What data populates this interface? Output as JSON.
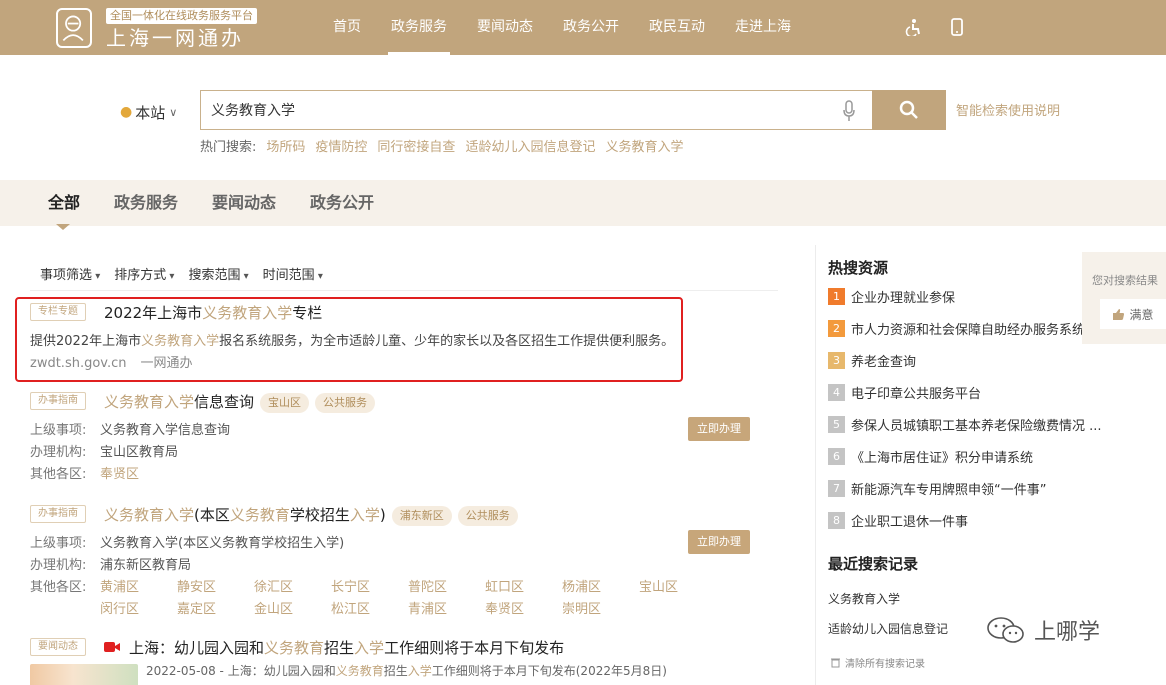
{
  "header": {
    "subtitle": "全国一体化在线政务服务平台",
    "title": "上海一网通办",
    "nav": [
      "首页",
      "政务服务",
      "要闻动态",
      "政务公开",
      "政民互动",
      "走进上海"
    ],
    "active_nav": "政务服务"
  },
  "search": {
    "location": "本站",
    "value": "义务教育入学",
    "help": "智能检索使用说明",
    "hot_label": "热门搜索:",
    "hot_terms": [
      "场所码",
      "疫情防控",
      "同行密接自查",
      "适龄幼儿入园信息登记",
      "义务教育入学"
    ]
  },
  "tabs": [
    "全部",
    "政务服务",
    "要闻动态",
    "政务公开"
  ],
  "filters": [
    "事项筛选",
    "排序方式",
    "搜索范围",
    "时间范围"
  ],
  "results": {
    "r1": {
      "tag": "专栏专题",
      "title_a": "2022年上海市",
      "title_hl": "义务教育入学",
      "title_b": "专栏",
      "desc_a": "提供2022年上海市",
      "desc_hl": "义务教育入学",
      "desc_b": "报名系统服务，为全市适龄儿童、少年的家长以及各区招生工作提供便利服务。",
      "url": "zwdt.sh.gov.cn",
      "source": "一网通办"
    },
    "r2": {
      "tag": "办事指南",
      "title_hl": "义务教育入学",
      "title_b": "信息查询",
      "pills": [
        "宝山区",
        "公共服务"
      ],
      "k1": "上级事项:",
      "v1": "义务教育入学信息查询",
      "k2": "办理机构:",
      "v2": "宝山区教育局",
      "k3": "其他各区:",
      "v3": "奉贤区",
      "button": "立即办理"
    },
    "r3": {
      "tag": "办事指南",
      "t1": "义务教育入学",
      "t2": "(本区",
      "t3": "义务教育",
      "t4": "学校招生",
      "t5": "入学",
      "t6": ")",
      "pills": [
        "浦东新区",
        "公共服务"
      ],
      "k1": "上级事项:",
      "v1": "义务教育入学(本区义务教育学校招生入学)",
      "k2": "办理机构:",
      "v2": "浦东新区教育局",
      "k3": "其他各区:",
      "districts": [
        "黄浦区",
        "静安区",
        "徐汇区",
        "长宁区",
        "普陀区",
        "虹口区",
        "杨浦区",
        "宝山区",
        "闵行区",
        "嘉定区",
        "金山区",
        "松江区",
        "青浦区",
        "奉贤区",
        "崇明区"
      ],
      "button": "立即办理"
    },
    "r4": {
      "tag": "要闻动态",
      "t1": "上海：幼儿园入园和",
      "t2": "义务教育",
      "t3": "招生",
      "t4": "入学",
      "t5": "工作细则将于本月下旬发布",
      "d1": "2022-05-08 - 上海：幼儿园入园和",
      "d2": "义务教育",
      "d3": "招生",
      "d4": "入学",
      "d5": "工作细则将于本月下旬发布(2022年5月8日)"
    }
  },
  "sidebar": {
    "hot_title": "热搜资源",
    "hot_items": [
      "企业办理就业参保",
      "市人力资源和社会保障自助经办服务系统",
      "养老金查询",
      "电子印章公共服务平台",
      "参保人员城镇职工基本养老保险缴费情况 ...",
      "《上海市居住证》积分申请系统",
      "新能源汽车专用牌照申领“一件事”",
      "企业职工退休一件事"
    ],
    "ranks": [
      "1",
      "2",
      "3",
      "4",
      "5",
      "6",
      "7",
      "8"
    ],
    "rank_colors": [
      "#f07b2c",
      "#f39a3c",
      "#e7b86c",
      "#c4c4c4",
      "#c4c4c4",
      "#c4c4c4",
      "#c4c4c4",
      "#c4c4c4"
    ],
    "recent_title": "最近搜索记录",
    "recent_items": [
      "义务教育入学",
      "适龄幼儿入园信息登记"
    ],
    "clear": "清除所有搜索记录"
  },
  "feedback": {
    "question": "您对搜索结果",
    "button": "满意"
  },
  "watermark": "上哪学",
  "colors": {
    "brand": "#c1a57d",
    "highlight": "#c1a57d",
    "annotation": "#e02020"
  }
}
